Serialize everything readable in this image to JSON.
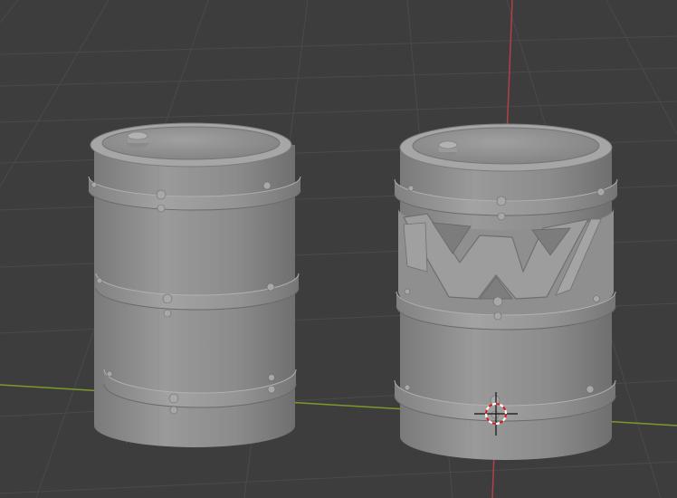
{
  "viewport": {
    "background": "#3d3d3d",
    "grid_color": "#4a4a4a",
    "x_axis_color": "#7c9a2a",
    "y_axis_color": "#b0404a"
  },
  "objects": [
    {
      "name": "barrel-plain",
      "color": "#8e8e8e"
    },
    {
      "name": "barrel-decorated",
      "color": "#8e8e8e"
    }
  ],
  "cursor": {
    "icon": "3d-cursor-icon",
    "ring_colors": [
      "#cc2222",
      "#ffffff"
    ]
  }
}
